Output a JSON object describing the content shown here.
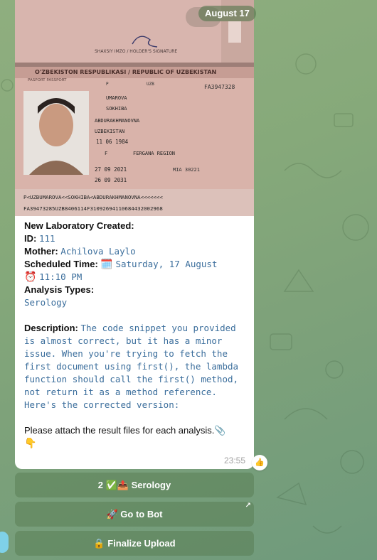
{
  "date_pill": "August 17",
  "passport": {
    "top_label": "SHAXSIY IMZO / HOLDER'S SIGNATURE",
    "header": "O'ZBEKISTON RESPUBLIKASI / REPUBLIC OF UZBEKISTAN",
    "doc_label": "PASPORT   PASSPORT",
    "type": "P",
    "country": "UZB",
    "number": "FA3947328",
    "surname": "UMAROVA",
    "given_names": "SOKHIBA",
    "patronymic": "ABDURAKHMANOVNA",
    "nationality": "UZBEKISTAN",
    "dob": "11 06 1984",
    "sex": "F",
    "place_of_birth": "FERGANA REGION",
    "issue_date": "27 09 2021",
    "authority": "MIA 30221",
    "expiry_date": "26 09 2031",
    "mrz1": "P<UZBUMAROVA<<SOKHIBA<ABDURAKHMANOVNA<<<<<<<",
    "mrz2": "FA39473285UZB8406114F31092694110684432002968"
  },
  "message": {
    "title": "New Laboratory Created:",
    "id_label": "ID:",
    "id_value": "111",
    "mother_label": "Mother:",
    "mother_value": "Achilova Laylo",
    "scheduled_label": "Scheduled Time:",
    "calendar_emoji": "🗓️",
    "scheduled_date": "Saturday, 17 August",
    "clock_emoji": "⏰",
    "scheduled_time": "11:10 PM",
    "analysis_label": "Analysis Types:",
    "analysis_value": "Serology",
    "description_label": "Description:",
    "description_value": "The code snippet you provided is almost correct, but it has a minor issue. When you're trying to fetch the first document using first(), the lambda function should call the first() method, not return it as a method reference. Here's the corrected version:",
    "footer": "Please attach the result files for each analysis.📎",
    "footer_emoji": "👇",
    "time": "23:55"
  },
  "reaction": "👍",
  "buttons": [
    {
      "label": "2 ✅📤 Serology"
    },
    {
      "label": "🚀 Go to Bot",
      "corner": "↗"
    },
    {
      "label": "🔒 Finalize Upload"
    }
  ]
}
